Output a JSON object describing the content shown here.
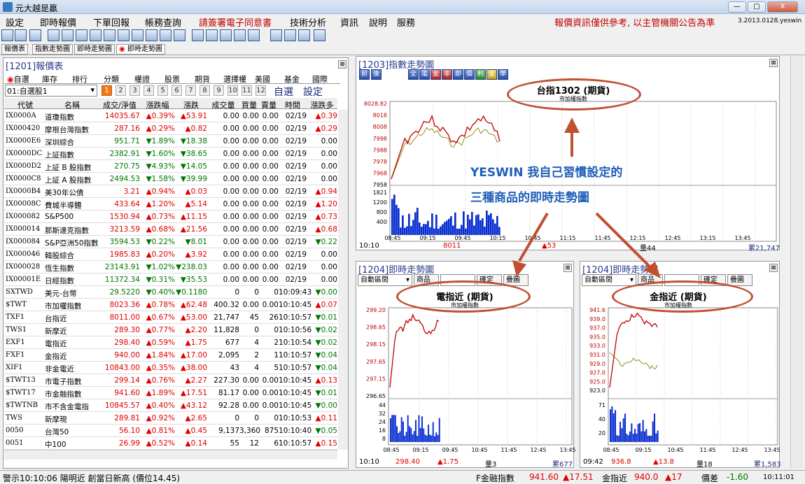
{
  "window": {
    "title": "元大越是贏",
    "minimize": "—",
    "maximize": "▢",
    "close": "X"
  },
  "menu": {
    "items": [
      "設定",
      "即時報價",
      "下單回報",
      "帳務查詢",
      "請簽署電子同意書",
      "技術分析",
      "資訊",
      "說明",
      "服務"
    ],
    "notice": "報價資訊僅供參考, 以主管機關公告為準",
    "version": "3.2013.0128.yeswin"
  },
  "subtabs": [
    "報價表",
    "指數走勢圖",
    "即時走勢圖",
    "即時走勢圖"
  ],
  "quote": {
    "title": "[1201]報價表",
    "tabs": [
      "自選",
      "庫存",
      "排行",
      "分類",
      "權證",
      "股票",
      "期貨",
      "選擇權",
      "美國",
      "基金",
      "國際"
    ],
    "group": "01:自選股1",
    "pages": [
      "1",
      "2",
      "3",
      "4",
      "5",
      "6",
      "7",
      "8",
      "9",
      "10",
      "11",
      "12"
    ],
    "btn_select": "自選",
    "btn_settings": "設定",
    "headers": [
      "代號",
      "名稱",
      "成交/淨值",
      "漲跌幅",
      "漲跌",
      "成交量",
      "買量",
      "賣量",
      "時間",
      "漲跌多"
    ],
    "rows": [
      [
        "IX0000A",
        "道瓊指數",
        "14035.67",
        "▲0.39%",
        "▲53.91",
        "0.00",
        "0.00",
        "0.00",
        "02/19",
        "▲0.39",
        "up"
      ],
      [
        "IX000420",
        "摩根台灣指數",
        "287.16",
        "▲0.29%",
        "▲0.82",
        "0.00",
        "0.00",
        "0.00",
        "02/19",
        "▲0.29",
        "up"
      ],
      [
        "IX0000E6",
        "深圳綜合",
        "951.71",
        "▼1.89%",
        "▼18.38",
        "0.00",
        "0.00",
        "0.00",
        "02/19",
        "0.00",
        "dn"
      ],
      [
        "IX0000DC",
        "上証指數",
        "2382.91",
        "▼1.60%",
        "▼38.65",
        "0.00",
        "0.00",
        "0.00",
        "02/19",
        "0.00",
        "dn"
      ],
      [
        "IX0000D2",
        "上証 B 股指數",
        "270.75",
        "▼4.93%",
        "▼14.05",
        "0.00",
        "0.00",
        "0.00",
        "02/19",
        "0.00",
        "dn"
      ],
      [
        "IX0000C8",
        "上証 A 股指數",
        "2494.53",
        "▼1.58%",
        "▼39.99",
        "0.00",
        "0.00",
        "0.00",
        "02/19",
        "0.00",
        "dn"
      ],
      [
        "IX0000B4",
        "美30年公債",
        "3.21",
        "▲0.94%",
        "▲0.03",
        "0.00",
        "0.00",
        "0.00",
        "02/19",
        "▲0.94",
        "up"
      ],
      [
        "IX00008C",
        "費城半導體",
        "433.64",
        "▲1.20%",
        "▲5.14",
        "0.00",
        "0.00",
        "0.00",
        "02/19",
        "▲1.20",
        "up"
      ],
      [
        "IX000082",
        "S&P500",
        "1530.94",
        "▲0.73%",
        "▲11.15",
        "0.00",
        "0.00",
        "0.00",
        "02/19",
        "▲0.73",
        "up"
      ],
      [
        "IX000014",
        "那斯達克指數",
        "3213.59",
        "▲0.68%",
        "▲21.56",
        "0.00",
        "0.00",
        "0.00",
        "02/19",
        "▲0.68",
        "up"
      ],
      [
        "IX000084",
        "S&P亞洲50指數",
        "3594.53",
        "▼0.22%",
        "▼8.01",
        "0.00",
        "0.00",
        "0.00",
        "02/19",
        "▼0.22",
        "dn"
      ],
      [
        "IX000046",
        "韓股綜合",
        "1985.83",
        "▲0.20%",
        "▲3.92",
        "0.00",
        "0.00",
        "0.00",
        "02/19",
        "0.00",
        "up"
      ],
      [
        "IX000028",
        "恆生指數",
        "23143.91",
        "▼1.02%",
        "▼238.03",
        "0.00",
        "0.00",
        "0.00",
        "02/19",
        "0.00",
        "dn"
      ],
      [
        "IX00001E",
        "日經指數",
        "11372.34",
        "▼0.31%",
        "▼35.53",
        "0.00",
        "0.00",
        "0.00",
        "02/19",
        "0.00",
        "dn"
      ],
      [
        "SXTWD",
        "美元-台幣",
        "29.5220",
        "▼0.40%",
        "▼0.1180",
        "0",
        "0",
        "0",
        "10:09:43",
        "▼0.00",
        "dn"
      ],
      [
        "$TWT",
        "市加權指數",
        "8023.36",
        "▲0.78%",
        "▲62.48",
        "400.32",
        "0.00",
        "0.00",
        "10:10:45",
        "▲0.07",
        "up"
      ],
      [
        "TXF1",
        "台指近",
        "8011.00",
        "▲0.67%",
        "▲53.00",
        "21,747",
        "45",
        "26",
        "10:10:57",
        "▼0.01",
        "up"
      ],
      [
        "TWS1",
        "新摩近",
        "289.30",
        "▲0.77%",
        "▲2.20",
        "11,828",
        "0",
        "0",
        "10:10:56",
        "▼0.02",
        "up"
      ],
      [
        "EXF1",
        "電指近",
        "298.40",
        "▲0.59%",
        "▲1.75",
        "677",
        "4",
        "2",
        "10:10:54",
        "▼0.02",
        "up"
      ],
      [
        "FXF1",
        "金指近",
        "940.00",
        "▲1.84%",
        "▲17.00",
        "2,095",
        "2",
        "1",
        "10:10:57",
        "▼0.04",
        "up"
      ],
      [
        "XIF1",
        "非金電近",
        "10843.00",
        "▲0.35%",
        "▲38.00",
        "43",
        "4",
        "5",
        "10:10:57",
        "▼0.04",
        "up"
      ],
      [
        "$TWT13",
        "市電子指數",
        "299.14",
        "▲0.76%",
        "▲2.27",
        "227.30",
        "0.00",
        "0.00",
        "10:10:45",
        "▲0.13",
        "up"
      ],
      [
        "$TWT17",
        "市金融指數",
        "941.60",
        "▲1.89%",
        "▲17.51",
        "81.17",
        "0.00",
        "0.00",
        "10:10:45",
        "▼0.01",
        "up"
      ],
      [
        "$TWTNB",
        "市不含金電指",
        "10845.57",
        "▲0.40%",
        "▲43.12",
        "92.28",
        "0.00",
        "0.00",
        "10:10:45",
        "▼0.00",
        "up"
      ],
      [
        "TWS",
        "新摩現",
        "289.81",
        "▲0.92%",
        "▲2.65",
        "0",
        "0",
        "0",
        "10:10:53",
        "▲0.11",
        "up"
      ],
      [
        "0050",
        "台灣50",
        "56.10",
        "▲0.81%",
        "▲0.45",
        "9,137",
        "3,360",
        "875",
        "10:10:40",
        "▼0.05",
        "up"
      ],
      [
        "0051",
        "中100",
        "26.99",
        "▲0.52%",
        "▲0.14",
        "55",
        "12",
        "6",
        "10:10:57",
        "▲0.15",
        "up"
      ]
    ]
  },
  "index_chart": {
    "title": "[1203]指數走勢圖",
    "main_title": "台指1302 (期貨)",
    "sub": "市加權指數",
    "ylabels": [
      "8028.82",
      "8018",
      "8008",
      "7998",
      "7988",
      "7978",
      "7968",
      "7958"
    ],
    "vlabels": [
      "1821",
      "1200",
      "800",
      "400"
    ],
    "xlabels": [
      "08:45",
      "09:15",
      "09:45",
      "10:15",
      "10:45",
      "11:15",
      "11:45",
      "12:15",
      "12:45",
      "13:15",
      "13:45"
    ],
    "footer": {
      "time": "10:10",
      "price": "8011",
      "change": "▲53",
      "volume": "量44",
      "total": "累21,747"
    },
    "buttons": [
      "前",
      "後",
      "全",
      "電",
      "金",
      "非",
      "即",
      "價",
      "利",
      "金",
      "學"
    ]
  },
  "annotation": {
    "line1": "YESWIN 我自己習慣設定的",
    "line2": "三種商品的即時走勢圖"
  },
  "chart_elec": {
    "title": "[1204]即時走勢圖",
    "mode": "自動區間",
    "product_btn": "商品",
    "ok": "確定",
    "overlay": "疊圖",
    "main_title": "電指近 (期貨)",
    "sub": "市加權指數",
    "ylabels": [
      "299.20",
      "298.65",
      "298.15",
      "297.65",
      "297.15",
      "296.65"
    ],
    "vlabels": [
      "44",
      "32",
      "24",
      "16",
      "8"
    ],
    "xlabels": [
      "08:45",
      "09:15",
      "09:45",
      "10:45",
      "11:45",
      "12:45",
      "13:45"
    ],
    "footer": {
      "time": "10:10",
      "price": "298.40",
      "change": "▲1.75",
      "volume": "量3",
      "total": "累677"
    }
  },
  "chart_fin": {
    "title": "[1204]即時走勢圖",
    "mode": "自動區間",
    "product_btn": "商品",
    "ok": "確定",
    "overlay": "疊圖",
    "main_title": "金指近 (期貨)",
    "sub": "市加權指數",
    "ylabels": [
      "941.6",
      "939.0",
      "937.0",
      "935.0",
      "933.0",
      "931.0",
      "929.0",
      "927.0",
      "925.0",
      "923.0"
    ],
    "vlabels": [
      "71",
      "40",
      "20"
    ],
    "xlabels": [
      "08:45",
      "09:15",
      "10:45",
      "11:45",
      "12:45",
      "13:45"
    ],
    "footer": {
      "time": "09:42",
      "price": "936.8",
      "change": "▲13.8",
      "volume": "量18",
      "total": "累1,583"
    }
  },
  "status": {
    "alert": "警示10:10:06  陽明近 創當日新高 (價位14.45)",
    "label1": "F金融指數",
    "val1": "941.60",
    "chg1": "▲17.51",
    "label2": "金指近",
    "val2": "940.0",
    "chg2": "▲17",
    "label3": "價差",
    "val3": "-1.60",
    "clock": "10:11:01"
  },
  "colors": {
    "up": "#e00000",
    "down": "#007700",
    "accent": "#c0502f",
    "annotation": "#1f5fb8"
  }
}
